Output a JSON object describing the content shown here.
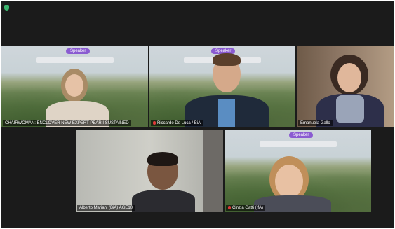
{
  "participants": [
    {
      "name": "CHAIRWOMAN: ENCLOVER NEW EXPERT PEAR I SUSTAINED",
      "badge": "Speaker",
      "mic": false
    },
    {
      "name": "Riccardo De Luca / BiA",
      "badge": "Speaker",
      "mic": true
    },
    {
      "name": "Emanuela Gallo",
      "badge": "",
      "mic": false
    },
    {
      "name": "Alberto Mariani (BiA) AGE10",
      "badge": "",
      "mic": false
    },
    {
      "name": "Cinzia Gatti (IfA)",
      "badge": "Speaker",
      "mic": true
    }
  ],
  "colors": {
    "active_border": "#d6d04a",
    "badge": "#8a5bd1",
    "mic_muted": "#e03a3a"
  }
}
